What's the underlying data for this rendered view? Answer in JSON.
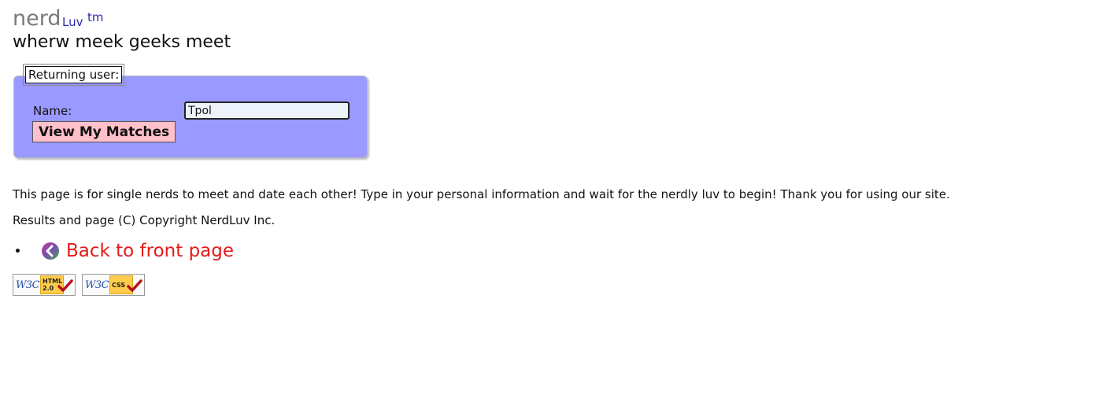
{
  "header": {
    "logo_main": "nerd",
    "logo_sub": "Luv",
    "logo_tm": "tm",
    "tagline": "wherw meek geeks meet"
  },
  "form": {
    "legend": "Returning user:",
    "name_label": "Name:",
    "name_value": "Tpol",
    "submit_label": "View My Matches",
    "colors": {
      "fieldset_bg": "#9999ff",
      "button_bg": "#ffc0cb"
    }
  },
  "content": {
    "intro": "This page is for single nerds to meet and date each other! Type in your personal information and wait for the nerdly luv to begin! Thank you for using our site.",
    "copyright": "Results and page (C) Copyright NerdLuv Inc."
  },
  "nav": {
    "back_label": "Back to front page",
    "back_icon": "back-arrow-icon",
    "link_color": "#e21a1a"
  },
  "badges": [
    {
      "w3c": "W3C",
      "label_line1": "HTML",
      "label_line2": "2.0",
      "icon": "checkmark-icon"
    },
    {
      "w3c": "W3C",
      "label_line1": "CSS",
      "label_line2": "",
      "icon": "checkmark-icon"
    }
  ]
}
